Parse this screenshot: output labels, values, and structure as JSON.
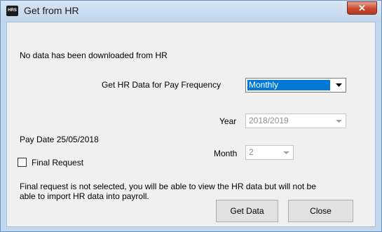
{
  "window": {
    "title": "Get from HR",
    "app_icon_text": "HRS"
  },
  "message": "No data has been downloaded from HR",
  "pay_frequency": {
    "label": "Get HR Data for Pay Frequency",
    "value": "Monthly"
  },
  "year": {
    "label": "Year",
    "value": "2018/2019"
  },
  "pay_date": "Pay Date 25/05/2018",
  "month": {
    "label": "Month",
    "value": "2"
  },
  "final_request": {
    "label": "Final Request",
    "checked": false
  },
  "info_line1": "Final request is not selected, you will be able to view the HR data but will not be",
  "info_line2": "able to import HR data into payroll.",
  "buttons": {
    "get_data": "Get Data",
    "close": "Close"
  }
}
